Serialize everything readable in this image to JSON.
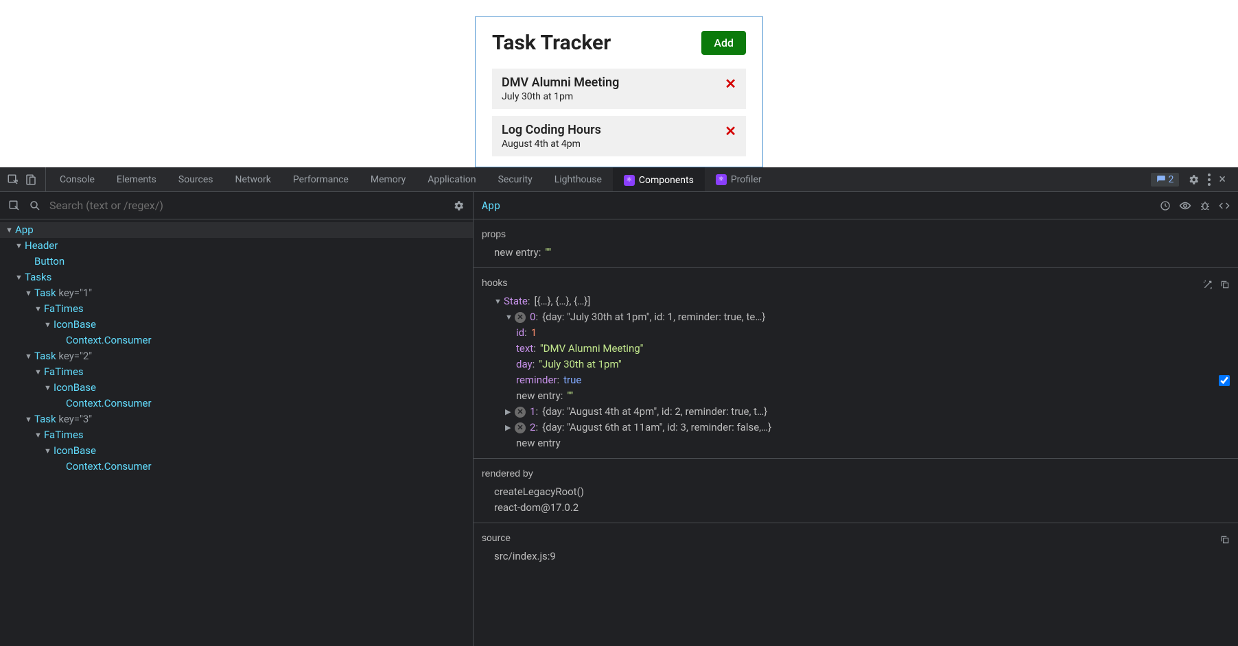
{
  "app": {
    "title": "Task Tracker",
    "add_button": "Add",
    "tasks": [
      {
        "text": "DMV Alumni Meeting",
        "day": "July 30th at 1pm"
      },
      {
        "text": "Log Coding Hours",
        "day": "August 4th at 4pm"
      }
    ]
  },
  "devtools": {
    "tabs": [
      "Console",
      "Elements",
      "Sources",
      "Network",
      "Performance",
      "Memory",
      "Application",
      "Security",
      "Lighthouse",
      "Components",
      "Profiler"
    ],
    "active_tab": "Components",
    "issues_count": "2",
    "search_placeholder": "Search (text or /regex/)"
  },
  "tree": {
    "root": "App",
    "header": "Header",
    "button": "Button",
    "tasks": "Tasks",
    "task": "Task",
    "fa": "FaTimes",
    "iconbase": "IconBase",
    "consumer": "Context.Consumer",
    "key_label": "key",
    "keys": [
      "1",
      "2",
      "3"
    ]
  },
  "inspector": {
    "component": "App",
    "props_label": "props",
    "hooks_label": "hooks",
    "rendered_label": "rendered by",
    "source_label": "source",
    "new_entry": "new entry",
    "empty": "\"\"",
    "state_key": "State",
    "state_summary": "[{…}, {…}, {…}]",
    "item0_summary": "{day: \"July 30th at 1pm\", id: 1, reminder: true, te…}",
    "item0": {
      "id": "1",
      "text": "\"DMV Alumni Meeting\"",
      "day": "\"July 30th at 1pm\"",
      "reminder": "true"
    },
    "item1_summary": "{day: \"August 4th at 4pm\", id: 2, reminder: true, t…}",
    "item2_summary": "{day: \"August 6th at 11am\", id: 3, reminder: false,…}",
    "rendered_lines": [
      "createLegacyRoot()",
      "react-dom@17.0.2"
    ],
    "source_line": "src/index.js:9"
  }
}
